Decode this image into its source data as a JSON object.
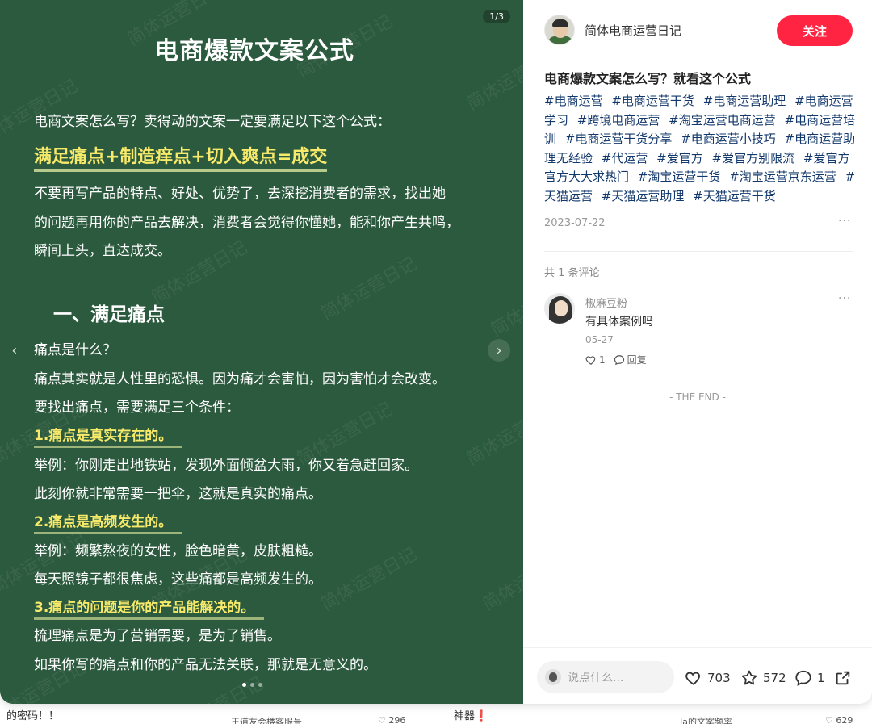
{
  "background_feed": {
    "item1_title": "的密码！！",
    "item2_author": "王道友会楼客服号",
    "item2_likes": "296",
    "item3_title": "神器",
    "item3_mark": "❗",
    "item4_author": "Ja的文案频率",
    "item4_likes": "629"
  },
  "slide": {
    "counter": "1/3",
    "watermark": "简体运营日记",
    "title": "电商爆款文案公式",
    "intro": "电商文案怎么写？卖得动的文案一定要满足以下这个公式：",
    "formula": "满足痛点+制造痒点+切入爽点=成交",
    "para_lines": [
      "不要再写产品的特点、好处、优势了，去深挖消费者的需求，找出她",
      "的问题再用你的产品去解决，消费者会觉得你懂她，能和你产生共鸣，",
      "瞬间上头，直达成交。"
    ],
    "section_heading": "一、满足痛点",
    "q_line": "痛点是什么？",
    "def_line1": "痛点其实就是人性里的恐惧。因为痛才会害怕，因为害怕才会改变。",
    "def_line2": "要找出痛点，需要满足三个条件：",
    "point1": "1.痛点是真实存在的。",
    "point1_ex1": "举例：你刚走出地铁站，发现外面倾盆大雨，你又着急赶回家。",
    "point1_ex2": "此刻你就非常需要一把伞，这就是真实的痛点。",
    "point2": "2.痛点是高频发生的。",
    "point2_ex1": "举例：频繁熬夜的女性，脸色暗黄，皮肤粗糙。",
    "point2_ex2": "每天照镜子都很焦虑，这些痛都是高频发生的。",
    "point3": "3.痛点的问题是你的产品能解决的。",
    "point3_ex1": "梳理痛点是为了营销需要，是为了销售。",
    "point3_ex2": "如果你写的痛点和你的产品无法关联，那就是无意义的。",
    "nav_prev": "‹",
    "nav_next": "›",
    "dot_count": 3,
    "active_dot": 1
  },
  "info": {
    "author_name": "简体电商运营日记",
    "follow_label": "关注",
    "note_title": "电商爆款文案怎么写？就看这个公式",
    "tags": [
      "#电商运营",
      "#电商运营干货",
      "#电商运营助理",
      "#电商运营学习",
      "#跨境电商运营",
      "#淘宝运营电商运营",
      "#电商运营培训",
      "#电商运营干货分享",
      "#电商运营小技巧",
      "#电商运营助理无经验",
      "#代运营",
      "#爱官方",
      "#爱官方别限流",
      "#爱官方官方大大求热门",
      "#淘宝运营干货",
      "#淘宝运营京东运营",
      "#天猫运营",
      "#天猫运营助理",
      "#天猫运营干货"
    ],
    "date": "2023-07-22",
    "more_label": "···",
    "comment_count": "共 1 条评论",
    "comment": {
      "author": "椒麻豆粉",
      "text": "有具体案例吗",
      "date": "05-27",
      "likes": "1",
      "reply_label": "回复"
    },
    "end_label": "- THE END -",
    "input_placeholder": "说点什么...",
    "likes": "703",
    "collects": "572",
    "comments": "1"
  },
  "colors": {
    "slide_bg": "#2c5a3e",
    "highlight": "#f7ea6a",
    "follow_bg": "#ff2442",
    "tag_color": "#13386c"
  },
  "icons": [
    "chevron-left-icon",
    "chevron-right-icon",
    "heart-icon",
    "star-icon",
    "comment-icon",
    "share-icon",
    "more-icon"
  ]
}
